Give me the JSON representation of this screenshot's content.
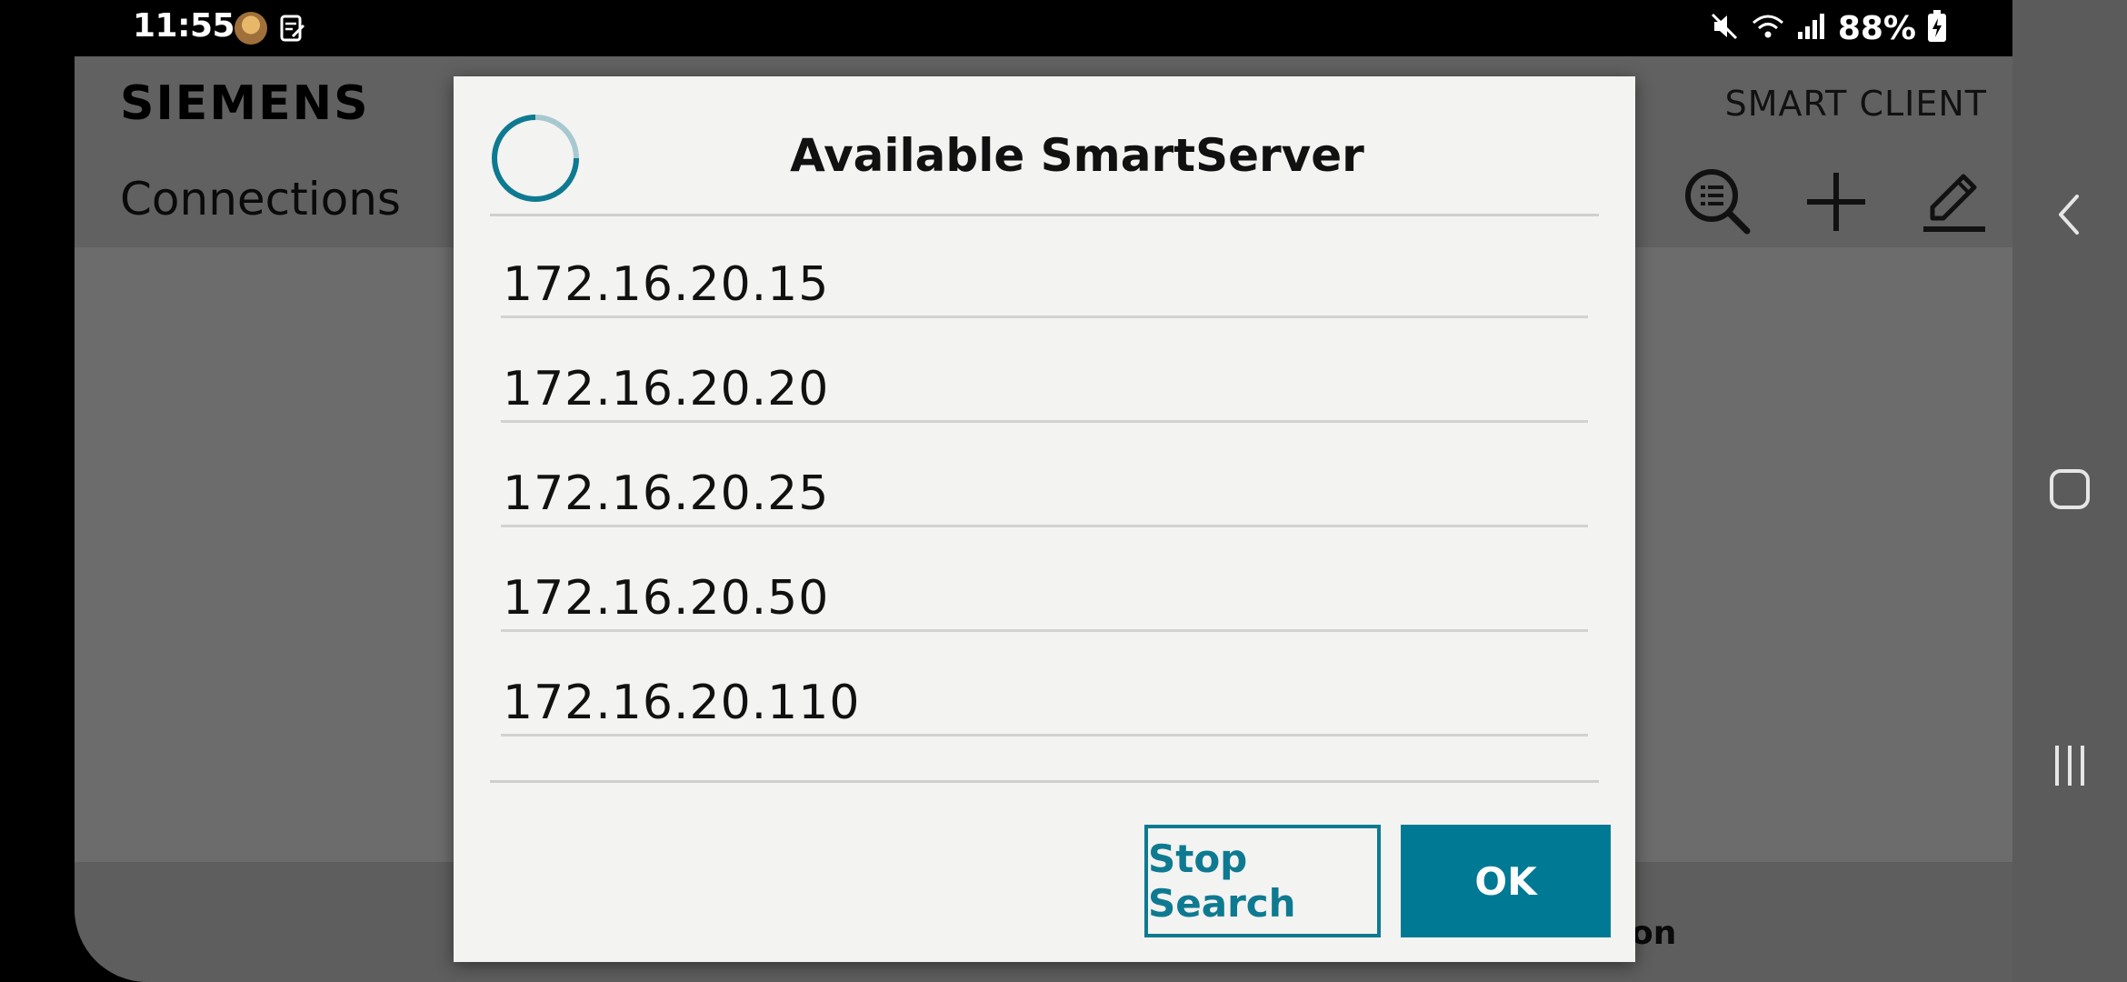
{
  "status_bar": {
    "time": "11:55",
    "battery": "88%",
    "icons": [
      "avatar-icon",
      "note-icon",
      "mute-icon",
      "wifi-icon",
      "signal-icon",
      "battery-charging-icon"
    ]
  },
  "app": {
    "brand": "SIEMENS",
    "product": "SMART CLIENT",
    "section_title": "Connections",
    "toolbar": [
      "search-list-icon",
      "add-icon",
      "edit-icon"
    ],
    "bottom_partial_label": "on"
  },
  "dialog": {
    "title": "Available SmartServer",
    "servers": [
      "172.16.20.15",
      "172.16.20.20",
      "172.16.20.25",
      "172.16.20.50",
      "172.16.20.110"
    ],
    "stop_search_label": "Stop Search",
    "ok_label": "OK"
  },
  "colors": {
    "accent": "#007a94",
    "dialog_bg": "#f3f3f1",
    "overlay": "#6b6b6b"
  },
  "nav": [
    "back-icon",
    "home-icon",
    "recents-icon"
  ]
}
